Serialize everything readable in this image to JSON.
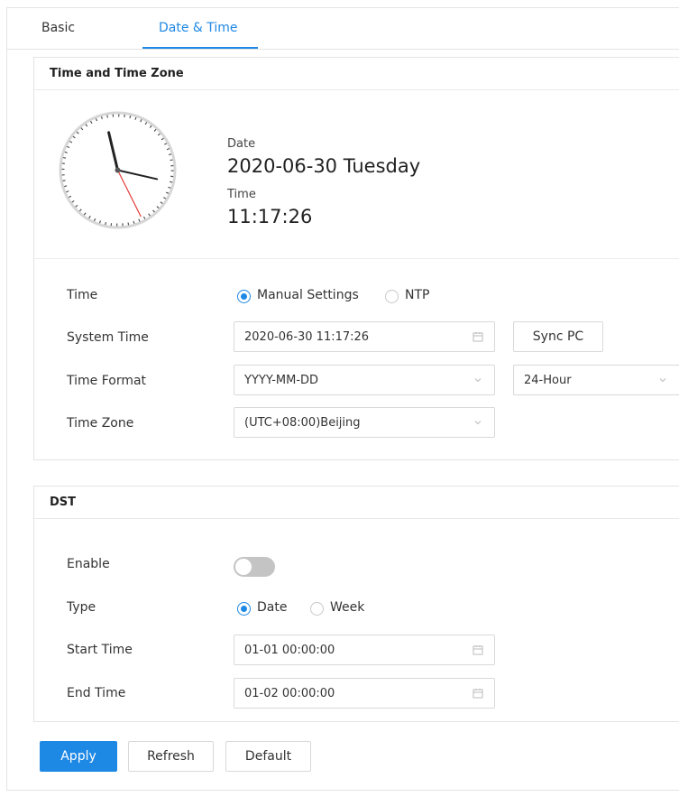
{
  "tabs": [
    {
      "label": "Basic",
      "active": false
    },
    {
      "label": "Date & Time",
      "active": true
    }
  ],
  "time_zone_section": {
    "title": "Time and Time Zone",
    "date_label": "Date",
    "date_value": "2020-06-30 Tuesday",
    "time_label": "Time",
    "time_value": "11:17:26",
    "fields": {
      "time": {
        "label": "Time",
        "options": [
          {
            "label": "Manual Settings",
            "selected": true
          },
          {
            "label": "NTP",
            "selected": false
          }
        ]
      },
      "system_time": {
        "label": "System Time",
        "value": "2020-06-30 11:17:26",
        "button": "Sync PC"
      },
      "time_format": {
        "label": "Time Format",
        "date_format": "YYYY-MM-DD",
        "hour_format": "24-Hour"
      },
      "time_zone": {
        "label": "Time Zone",
        "value": "(UTC+08:00)Beijing"
      }
    }
  },
  "dst_section": {
    "title": "DST",
    "enable": {
      "label": "Enable",
      "on": false
    },
    "type": {
      "label": "Type",
      "options": [
        {
          "label": "Date",
          "selected": true
        },
        {
          "label": "Week",
          "selected": false
        }
      ]
    },
    "start_time": {
      "label": "Start Time",
      "value": "01-01 00:00:00"
    },
    "end_time": {
      "label": "End Time",
      "value": "01-02 00:00:00"
    }
  },
  "actions": {
    "apply": "Apply",
    "refresh": "Refresh",
    "default": "Default"
  },
  "colors": {
    "accent": "#1e88e5",
    "border": "#d9d9d9",
    "second_hand": "#e53935"
  },
  "icons": {
    "calendar": "calendar-icon",
    "dropdown": "chevron-down-icon"
  }
}
